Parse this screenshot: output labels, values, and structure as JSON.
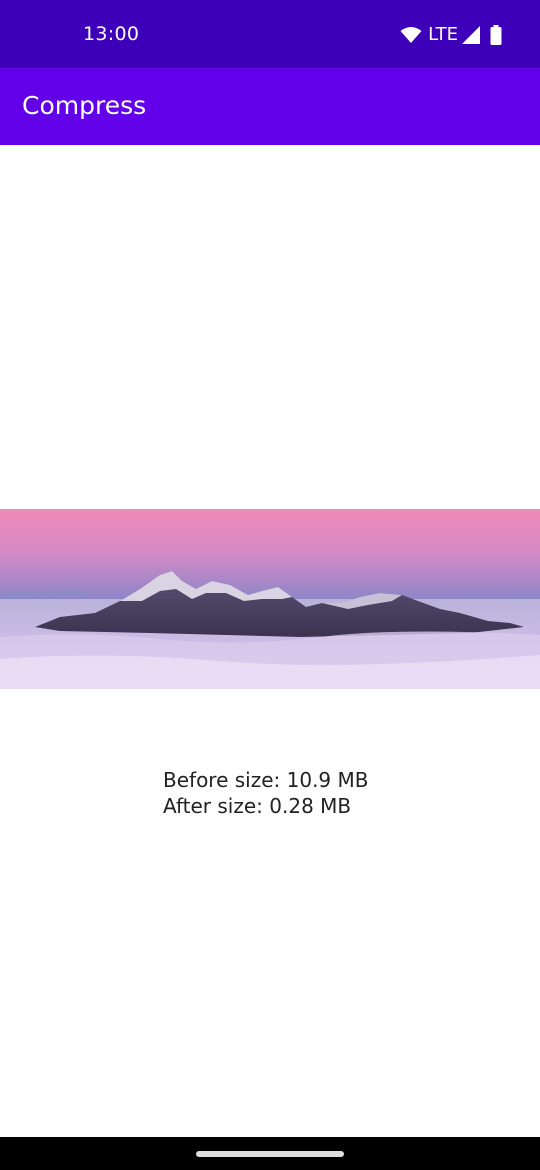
{
  "status_bar": {
    "time": "13:00",
    "network": "LTE",
    "icons": [
      "wifi-icon",
      "signal-icon",
      "battery-icon"
    ]
  },
  "app_bar": {
    "title": "Compress"
  },
  "image": {
    "description_icon": "mountain-photo"
  },
  "size_info": {
    "before": "Before size: 10.9 MB",
    "after": "After size: 0.28 MB"
  },
  "colors": {
    "status_bar": "#3d00b8",
    "app_bar": "#6200ea",
    "background": "#ffffff",
    "nav_bar": "#000000"
  }
}
